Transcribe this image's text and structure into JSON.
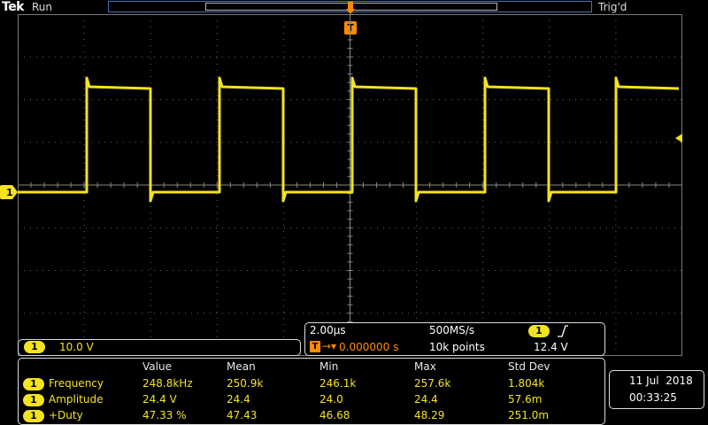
{
  "top_bar": {
    "brand": "Tek",
    "run_state": "Run",
    "trigger_state": "Trig'd"
  },
  "trigger": {
    "marker_label": "T"
  },
  "channel": {
    "number": "1",
    "scale": "10.0 V",
    "color": "#f4e320"
  },
  "horizontal": {
    "time_per_div": "2.00µs",
    "sample_rate": "500MS/s",
    "trigger_position_prefix": "T",
    "trigger_position_value": "0.000000 s",
    "record_length": "10k points",
    "trigger_channel": "1",
    "trigger_slope_icon": "rising-edge-icon",
    "trigger_level": "12.4 V"
  },
  "measurements": {
    "headers": [
      "Value",
      "Mean",
      "Min",
      "Max",
      "Std Dev"
    ],
    "rows": [
      {
        "channel": "1",
        "name": "Frequency",
        "value": "248.8kHz",
        "mean": "250.9k",
        "min": "246.1k",
        "max": "257.6k",
        "std": "1.804k"
      },
      {
        "channel": "1",
        "name": "Amplitude",
        "value": "24.4 V",
        "mean": "24.4",
        "min": "24.0",
        "max": "24.4",
        "std": "57.6m"
      },
      {
        "channel": "1",
        "name": "+Duty",
        "value": "47.33 %",
        "mean": "47.43",
        "min": "46.68",
        "max": "48.29",
        "std": "251.0m"
      }
    ]
  },
  "datetime": {
    "date": "11 Jul  2018",
    "time": "00:33:25"
  },
  "colors": {
    "trace": "#f4e320",
    "trigger": "#ff8a00",
    "record_bar": "#4a72b8"
  }
}
